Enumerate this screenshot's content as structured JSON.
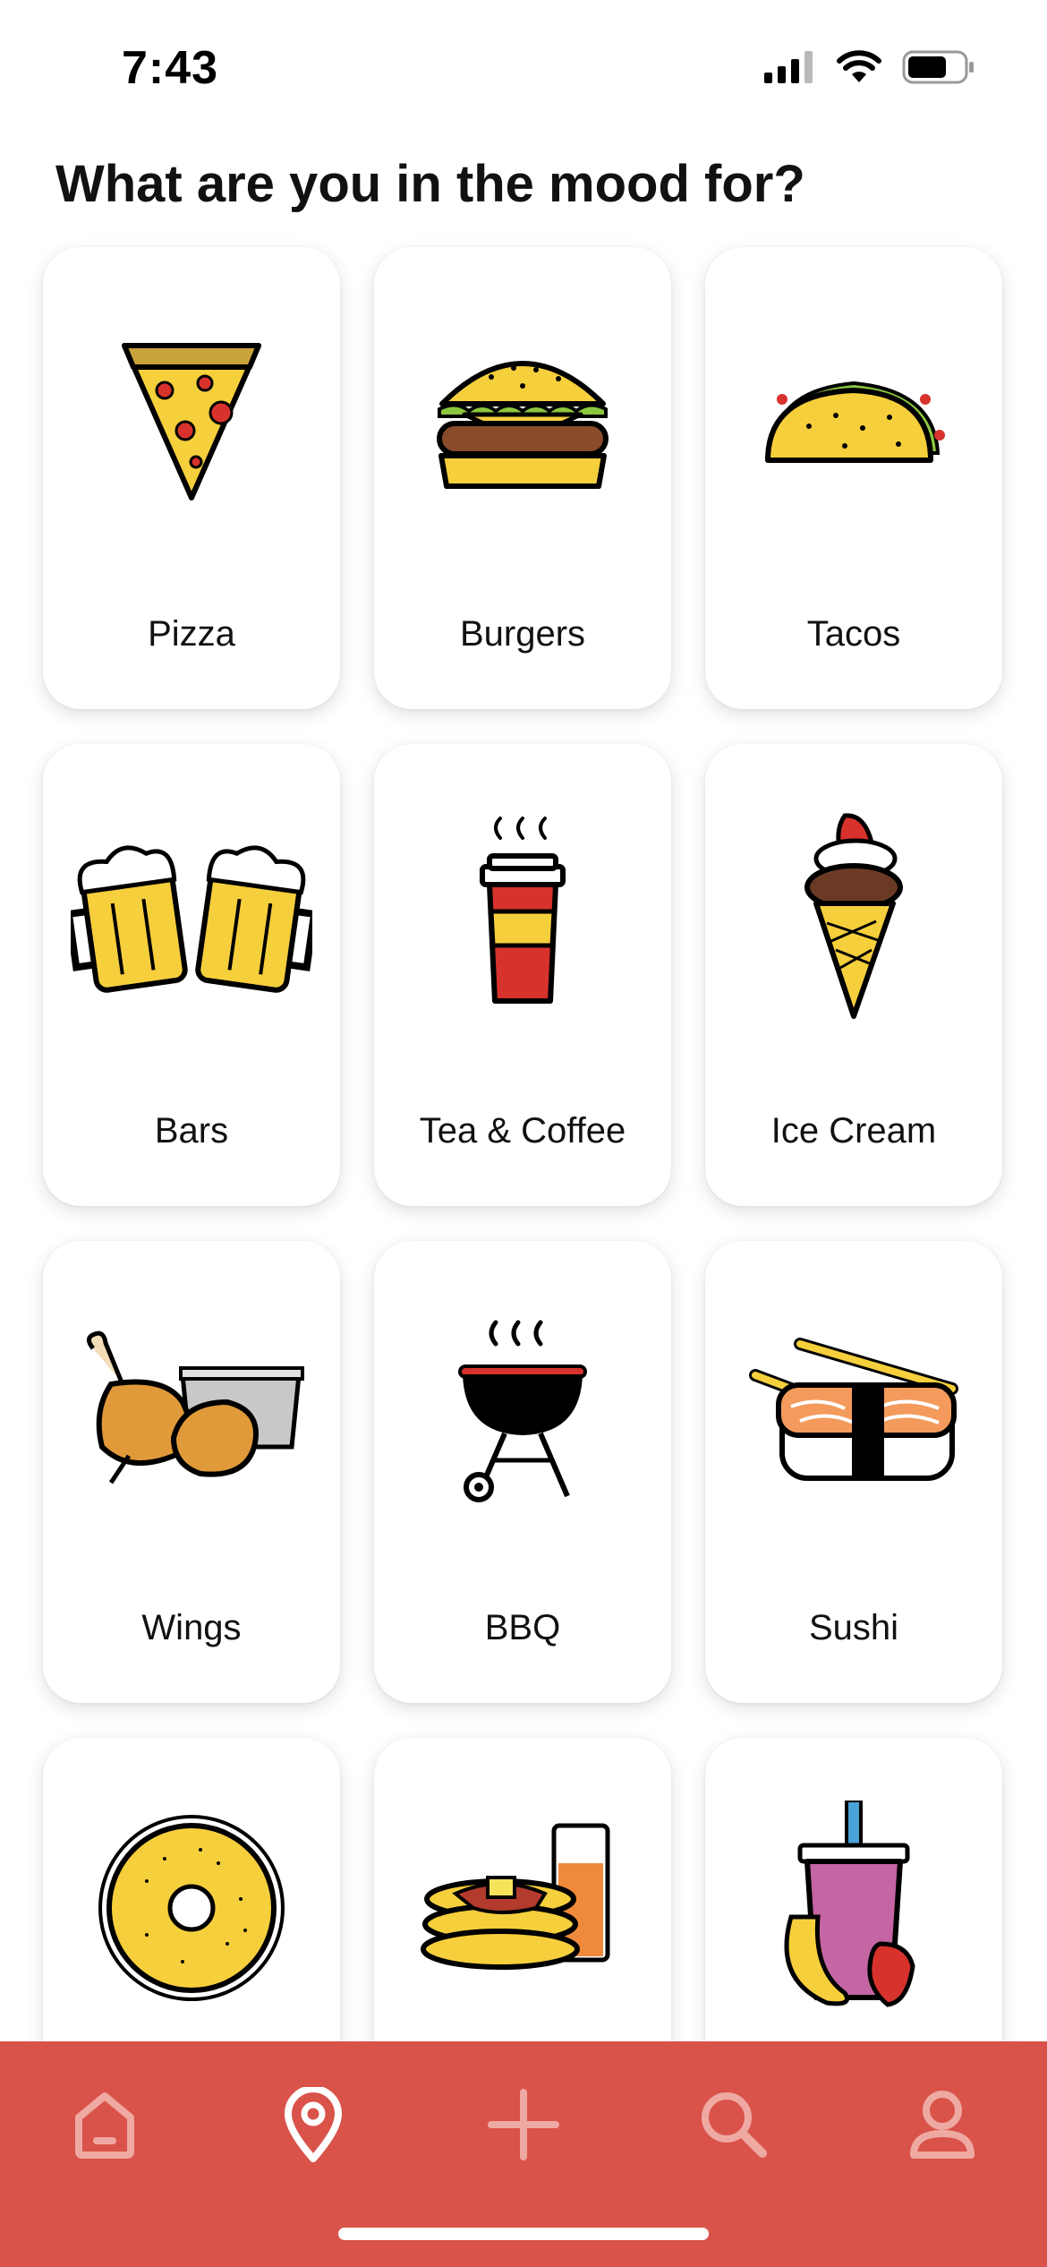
{
  "status_bar": {
    "time": "7:43"
  },
  "page": {
    "title": "What are you in the mood for?"
  },
  "categories": [
    {
      "label": "Pizza",
      "icon": "pizza-icon"
    },
    {
      "label": "Burgers",
      "icon": "burger-icon"
    },
    {
      "label": "Tacos",
      "icon": "taco-icon"
    },
    {
      "label": "Bars",
      "icon": "beer-mugs-icon"
    },
    {
      "label": "Tea & Coffee",
      "icon": "coffee-cup-icon"
    },
    {
      "label": "Ice Cream",
      "icon": "ice-cream-cone-icon"
    },
    {
      "label": "Wings",
      "icon": "chicken-wings-icon"
    },
    {
      "label": "BBQ",
      "icon": "grill-icon"
    },
    {
      "label": "Sushi",
      "icon": "sushi-icon"
    },
    {
      "label": "",
      "icon": "bagel-icon"
    },
    {
      "label": "",
      "icon": "pancakes-icon"
    },
    {
      "label": "",
      "icon": "smoothie-icon"
    }
  ],
  "tab_bar": {
    "items": [
      {
        "icon": "home-icon",
        "active": false
      },
      {
        "icon": "location-pin-icon",
        "active": true
      },
      {
        "icon": "plus-icon",
        "active": false
      },
      {
        "icon": "search-icon",
        "active": false
      },
      {
        "icon": "profile-icon",
        "active": false
      }
    ],
    "background": "#d9534a",
    "inactive_color": "#efa9a3",
    "active_color": "#ffffff"
  }
}
